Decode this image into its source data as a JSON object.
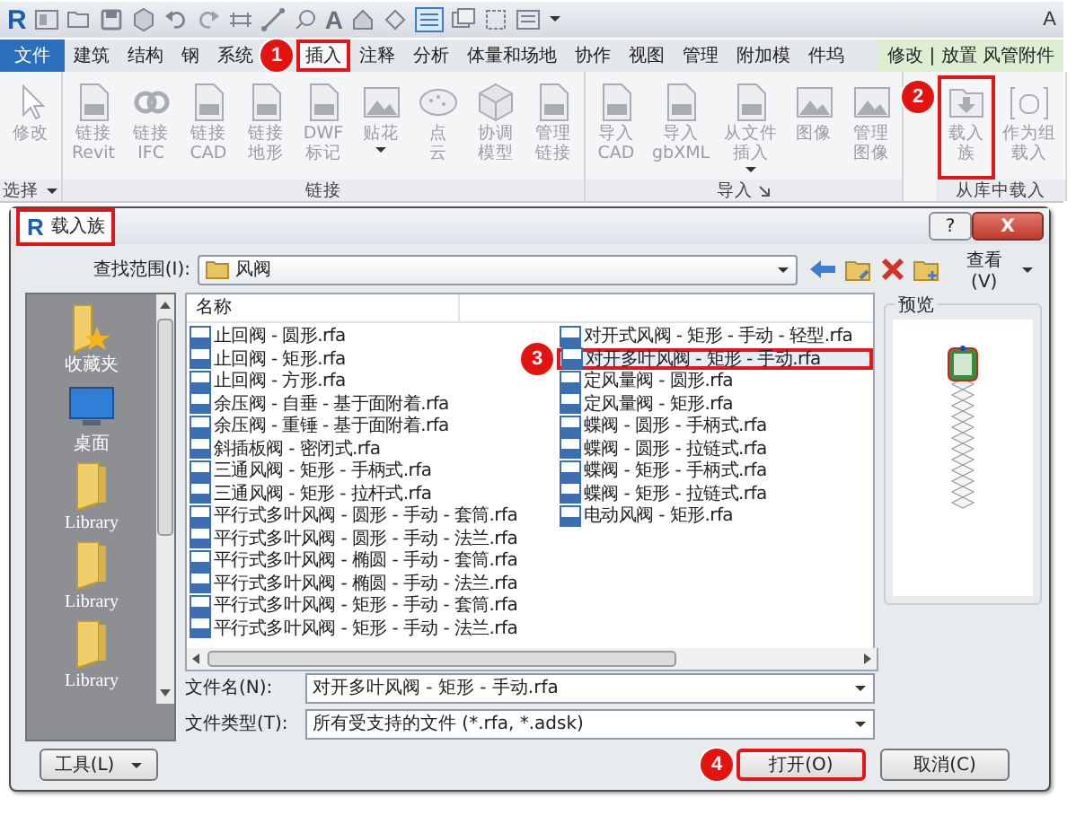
{
  "app": {
    "logo": "R",
    "title_fragment": "A",
    "quick_text_tool": "A"
  },
  "ribbon_tabs": [
    {
      "label": "文件",
      "kind": "file",
      "selected": false,
      "highlighted": false
    },
    {
      "label": "建筑",
      "kind": "tab",
      "selected": false,
      "highlighted": false
    },
    {
      "label": "结构",
      "kind": "tab",
      "selected": false,
      "highlighted": false
    },
    {
      "label": "钢",
      "kind": "tab",
      "selected": false,
      "highlighted": false
    },
    {
      "label": "系统",
      "kind": "tab",
      "selected": false,
      "highlighted": false
    },
    {
      "label": "插入",
      "kind": "tab",
      "selected": true,
      "highlighted": true,
      "callout": "1"
    },
    {
      "label": "注释",
      "kind": "tab",
      "selected": false,
      "highlighted": false
    },
    {
      "label": "分析",
      "kind": "tab",
      "selected": false,
      "highlighted": false
    },
    {
      "label": "体量和场地",
      "kind": "tab",
      "selected": false,
      "highlighted": false
    },
    {
      "label": "协作",
      "kind": "tab",
      "selected": false,
      "highlighted": false
    },
    {
      "label": "视图",
      "kind": "tab",
      "selected": false,
      "highlighted": false
    },
    {
      "label": "管理",
      "kind": "tab",
      "selected": false,
      "highlighted": false
    },
    {
      "label": "附加模",
      "kind": "tab",
      "selected": false,
      "highlighted": false
    },
    {
      "label": "件坞",
      "kind": "tab",
      "selected": false,
      "highlighted": false
    },
    {
      "label": "修改 | 放置 风管附件",
      "kind": "contextual",
      "selected": false,
      "highlighted": false
    }
  ],
  "ribbon_panels": [
    {
      "label": "选择",
      "dropdown": true,
      "buttons": [
        {
          "lines": [
            "修改"
          ],
          "highlighted": false
        }
      ]
    },
    {
      "label": "链接",
      "buttons": [
        {
          "lines": [
            "链接",
            "Revit"
          ],
          "highlighted": false
        },
        {
          "lines": [
            "链接",
            "IFC"
          ],
          "highlighted": false
        },
        {
          "lines": [
            "链接",
            "CAD"
          ],
          "highlighted": false
        },
        {
          "lines": [
            "链接",
            "地形"
          ],
          "highlighted": false
        },
        {
          "lines": [
            "DWF",
            "标记"
          ],
          "highlighted": false
        },
        {
          "lines": [
            "贴花"
          ],
          "dropdown": true,
          "highlighted": false
        },
        {
          "lines": [
            "点",
            "云"
          ],
          "highlighted": false
        },
        {
          "lines": [
            "协调",
            "模型"
          ],
          "highlighted": false
        },
        {
          "lines": [
            "管理",
            "链接"
          ],
          "highlighted": false
        }
      ]
    },
    {
      "label": "导入",
      "launcher": true,
      "buttons": [
        {
          "lines": [
            "导入",
            "CAD"
          ],
          "highlighted": false
        },
        {
          "lines": [
            "导入",
            "gbXML"
          ],
          "highlighted": false
        },
        {
          "lines": [
            "从文件",
            "插入"
          ],
          "dropdown": true,
          "highlighted": false
        },
        {
          "lines": [
            "图像"
          ],
          "highlighted": false
        },
        {
          "lines": [
            "管理",
            "图像"
          ],
          "highlighted": false
        }
      ]
    },
    {
      "label": "从库中载入",
      "buttons": [
        {
          "lines": [
            "载入",
            "族"
          ],
          "highlighted": true,
          "callout": "2"
        },
        {
          "lines": [
            "作为组",
            "载入"
          ],
          "highlighted": false
        }
      ]
    }
  ],
  "dialog": {
    "logo": "R",
    "title": "载入族",
    "title_highlighted": true,
    "help": "?",
    "close": "X",
    "look_in": {
      "label": "查找范围(I):",
      "value": "风阀"
    },
    "view_button": "查看(V)",
    "places": [
      {
        "label": "收藏夹",
        "kind": "favorites"
      },
      {
        "label": "桌面",
        "kind": "desktop"
      },
      {
        "label": "Library",
        "kind": "folder"
      },
      {
        "label": "Library",
        "kind": "folder"
      },
      {
        "label": "Library",
        "kind": "folder"
      }
    ],
    "columns": [
      "名称"
    ],
    "file_columns": [
      [
        {
          "name": "止回阀 - 圆形.rfa",
          "selected": false,
          "highlighted": false
        },
        {
          "name": "止回阀 - 矩形.rfa",
          "selected": false,
          "highlighted": false
        },
        {
          "name": "止回阀 - 方形.rfa",
          "selected": false,
          "highlighted": false
        },
        {
          "name": "余压阀 - 自垂 - 基于面附着.rfa",
          "selected": false,
          "highlighted": false
        },
        {
          "name": "余压阀 - 重锤 - 基于面附着.rfa",
          "selected": false,
          "highlighted": false
        },
        {
          "name": "斜插板阀 - 密闭式.rfa",
          "selected": false,
          "highlighted": false
        },
        {
          "name": "三通风阀 - 矩形 - 手柄式.rfa",
          "selected": false,
          "highlighted": false
        },
        {
          "name": "三通风阀 - 矩形 - 拉杆式.rfa",
          "selected": false,
          "highlighted": false
        },
        {
          "name": "平行式多叶风阀 - 圆形 - 手动 - 套筒.rfa",
          "selected": false,
          "highlighted": false
        },
        {
          "name": "平行式多叶风阀 - 圆形 - 手动 - 法兰.rfa",
          "selected": false,
          "highlighted": false
        },
        {
          "name": "平行式多叶风阀 - 椭圆 - 手动 - 套筒.rfa",
          "selected": false,
          "highlighted": false
        },
        {
          "name": "平行式多叶风阀 - 椭圆 - 手动 - 法兰.rfa",
          "selected": false,
          "highlighted": false
        },
        {
          "name": "平行式多叶风阀 - 矩形 - 手动 - 套筒.rfa",
          "selected": false,
          "highlighted": false
        },
        {
          "name": "平行式多叶风阀 - 矩形 - 手动 - 法兰.rfa",
          "selected": false,
          "highlighted": false
        }
      ],
      [
        {
          "name": "对开式风阀 - 矩形 - 手动 - 轻型.rfa",
          "selected": false,
          "highlighted": false
        },
        {
          "name": "对开多叶风阀 - 矩形 - 手动.rfa",
          "selected": true,
          "highlighted": true,
          "callout": "3"
        },
        {
          "name": "定风量阀 - 圆形.rfa",
          "selected": false,
          "highlighted": false
        },
        {
          "name": "定风量阀 - 矩形.rfa",
          "selected": false,
          "highlighted": false
        },
        {
          "name": "蝶阀 - 圆形 - 手柄式.rfa",
          "selected": false,
          "highlighted": false
        },
        {
          "name": "蝶阀 - 圆形 - 拉链式.rfa",
          "selected": false,
          "highlighted": false
        },
        {
          "name": "蝶阀 - 矩形 - 手柄式.rfa",
          "selected": false,
          "highlighted": false
        },
        {
          "name": "蝶阀 - 矩形 - 拉链式.rfa",
          "selected": false,
          "highlighted": false
        },
        {
          "name": "电动风阀 - 矩形.rfa",
          "selected": false,
          "highlighted": false
        }
      ]
    ],
    "preview": {
      "label": "预览"
    },
    "file_name": {
      "label": "文件名(N):",
      "value": "对开多叶风阀 - 矩形 - 手动.rfa"
    },
    "file_type": {
      "label": "文件类型(T):",
      "value": "所有受支持的文件 (*.rfa, *.adsk)"
    },
    "buttons": [
      {
        "label": "工具(L)",
        "kind": "tools",
        "dropdown": true,
        "highlighted": false
      },
      {
        "label": "打开(O)",
        "kind": "open",
        "highlighted": true,
        "callout": "4"
      },
      {
        "label": "取消(C)",
        "kind": "cancel",
        "highlighted": false
      }
    ]
  }
}
